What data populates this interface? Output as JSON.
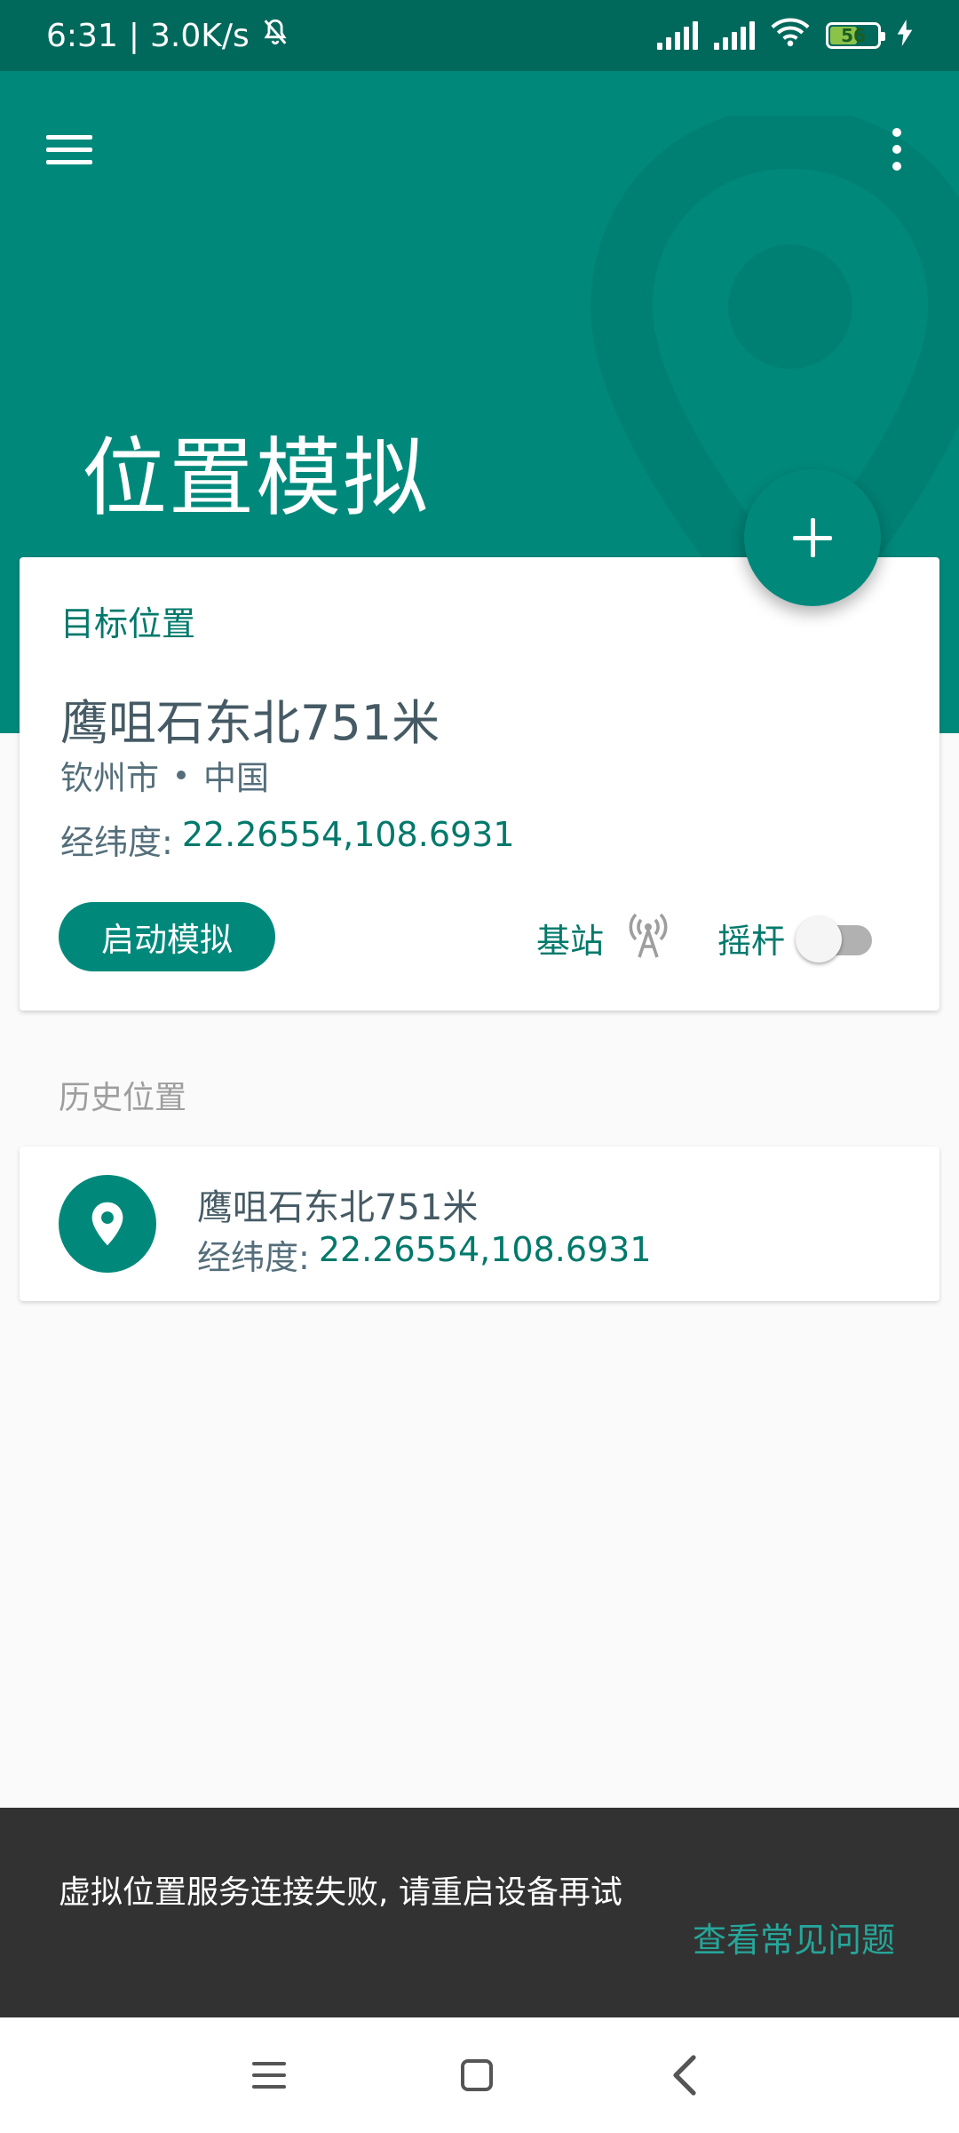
{
  "status_bar": {
    "time": "6:31",
    "separator": "|",
    "speed": "3.0K/s",
    "battery": "56"
  },
  "header": {
    "title": "位置模拟"
  },
  "target": {
    "label": "目标位置",
    "name": "鹰咀石东北751米",
    "city": "钦州市",
    "country": "中国",
    "coord_label": "经纬度:",
    "coord_value": "22.26554,108.6931",
    "start_button": "启动模拟",
    "base_station_label": "基站",
    "joystick_label": "摇杆",
    "joystick_enabled": false
  },
  "history": {
    "label": "历史位置",
    "items": [
      {
        "name": "鹰咀石东北751米",
        "coord_label": "经纬度:",
        "coord_value": "22.26554,108.6931"
      }
    ]
  },
  "snackbar": {
    "message": "虚拟位置服务连接失败, 请重启设备再试",
    "action": "查看常见问题"
  },
  "colors": {
    "primary": "#00897b",
    "primary_dark": "#00695c",
    "accent_text": "#00796b",
    "snackbar_bg": "#323232",
    "snackbar_action": "#26a69a"
  }
}
